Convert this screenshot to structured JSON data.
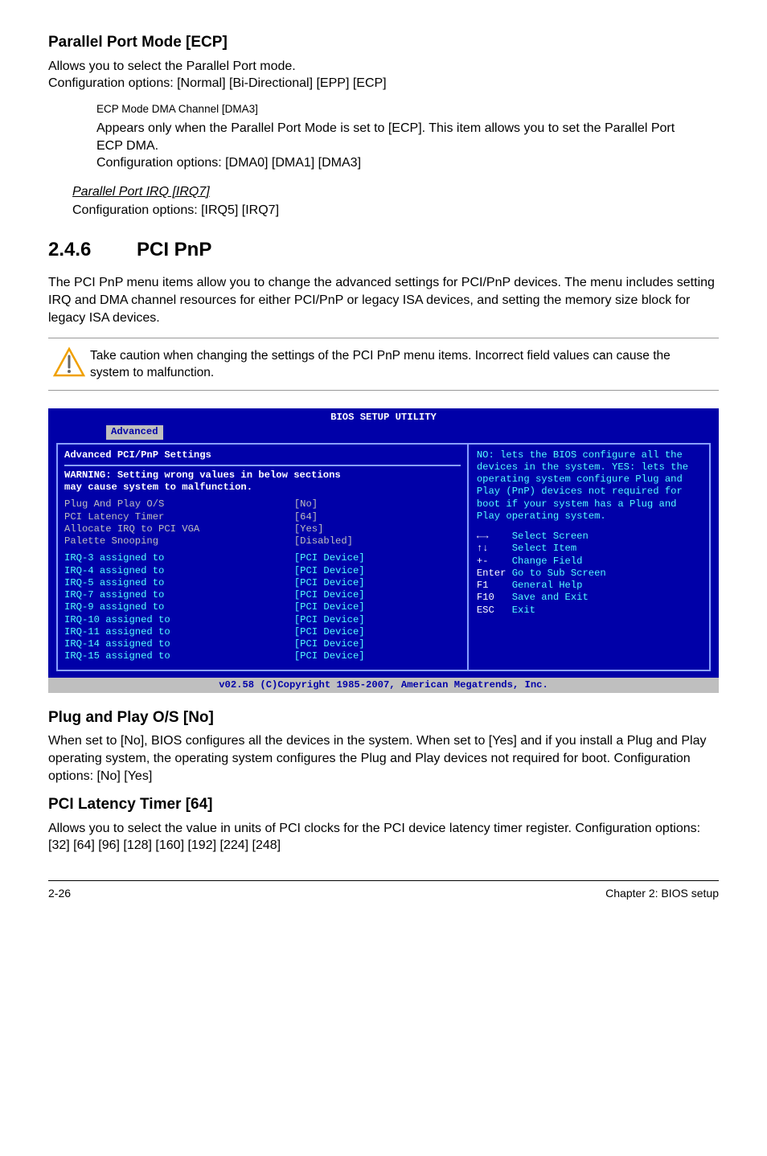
{
  "s1": {
    "title": "Parallel Port Mode [ECP]",
    "p1": "Allows you to select the Parallel Port  mode.",
    "p2": "Configuration options: [Normal] [Bi-Directional] [EPP] [ECP]",
    "sub1": {
      "title": "ECP Mode DMA Channel [DMA3]",
      "p1": "Appears only when the Parallel Port Mode is set to [ECP]. This item allows you to set the Parallel Port ECP DMA.",
      "p2": "Configuration options: [DMA0] [DMA1] [DMA3]"
    },
    "sub2": {
      "title": "Parallel Port IRQ [IRQ7]",
      "p1": "Configuration options: [IRQ5] [IRQ7]"
    }
  },
  "s2": {
    "num": "2.4.6",
    "title": "PCI PnP",
    "p1": "The PCI PnP menu items allow you to change the advanced settings for PCI/PnP devices. The menu includes setting IRQ and DMA channel resources for either PCI/PnP or legacy ISA devices, and setting the memory size block for legacy ISA devices.",
    "warn": "Take caution when changing the settings of the PCI PnP menu items. Incorrect field values can cause the system to malfunction."
  },
  "bios": {
    "title": "BIOS SETUP UTILITY",
    "tab": "Advanced",
    "heading": "Advanced PCI/PnP Settings",
    "warn1": "WARNING: Setting wrong values in below sections",
    "warn2": "         may cause system to malfunction.",
    "rows": [
      {
        "label": "Plug And Play O/S",
        "val": "[No]"
      },
      {
        "label": "PCI Latency Timer",
        "val": "[64]"
      },
      {
        "label": "Allocate IRQ to PCI VGA",
        "val": "[Yes]"
      },
      {
        "label": "Palette Snooping",
        "val": "[Disabled]"
      }
    ],
    "irqs": [
      {
        "label": "IRQ-3 assigned to",
        "val": "[PCI Device]"
      },
      {
        "label": "IRQ-4 assigned to",
        "val": "[PCI Device]"
      },
      {
        "label": "IRQ-5 assigned to",
        "val": "[PCI Device]"
      },
      {
        "label": "IRQ-7 assigned to",
        "val": "[PCI Device]"
      },
      {
        "label": "IRQ-9 assigned to",
        "val": "[PCI Device]"
      },
      {
        "label": "IRQ-10 assigned to",
        "val": "[PCI Device]"
      },
      {
        "label": "IRQ-11 assigned to",
        "val": "[PCI Device]"
      },
      {
        "label": "IRQ-14 assigned to",
        "val": "[PCI Device]"
      },
      {
        "label": "IRQ-15 assigned to",
        "val": "[PCI Device]"
      }
    ],
    "help": "NO: lets the BIOS configure  all the devices in the system. YES: lets the operating system configure Plug and Play (PnP) devices not required for boot if your system has a Plug and Play operating system.",
    "keys": [
      {
        "k": "←→   ",
        "d": "Select Screen"
      },
      {
        "k": "↑↓   ",
        "d": "Select Item"
      },
      {
        "k": "+-   ",
        "d": "Change Field"
      },
      {
        "k": "Enter",
        "d": "Go to Sub Screen"
      },
      {
        "k": "F1   ",
        "d": "General Help"
      },
      {
        "k": "F10  ",
        "d": "Save and Exit"
      },
      {
        "k": "ESC  ",
        "d": "Exit"
      }
    ],
    "footer": "v02.58 (C)Copyright 1985-2007, American Megatrends, Inc."
  },
  "s3": {
    "t1": "Plug and Play O/S [No]",
    "p1": "When set to [No], BIOS configures all the devices in the system. When set to [Yes] and if you install a Plug and Play operating system, the operating system configures the Plug and Play devices not required for boot. Configuration options: [No] [Yes]",
    "t2": "PCI Latency Timer [64]",
    "p2": "Allows you to select the value in units of PCI clocks for the PCI device latency timer register. Configuration options: [32] [64] [96] [128] [160] [192] [224] [248]"
  },
  "footer": {
    "left": "2-26",
    "right": "Chapter 2: BIOS setup"
  }
}
